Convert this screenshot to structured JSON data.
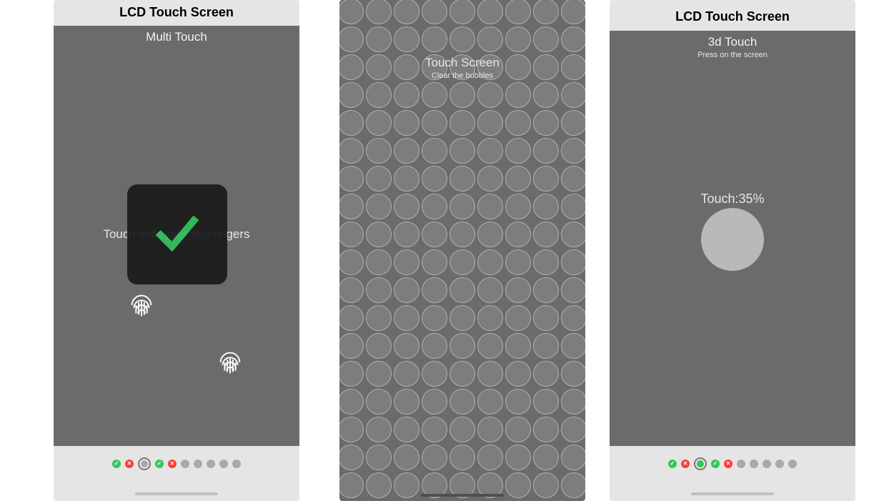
{
  "screen1": {
    "header": "LCD Touch Screen",
    "subtitle": "Multi Touch",
    "instruction": "Touch with your two fingers",
    "dots": [
      "pass",
      "fail",
      "current-todo",
      "pass",
      "fail",
      "todo",
      "todo",
      "todo",
      "todo",
      "todo"
    ]
  },
  "screen2": {
    "title": "Touch Screen",
    "subtitle": "Clear the bubbles",
    "grid": {
      "rows": 18,
      "cols": 9
    }
  },
  "screen3": {
    "header": "LCD Touch Screen",
    "subtitle": "3d Touch",
    "subtext": "Press on the screen",
    "touch_label": "Touch:",
    "touch_value": "35%",
    "dots": [
      "pass",
      "fail",
      "current-pass",
      "pass",
      "fail",
      "todo",
      "todo",
      "todo",
      "todo",
      "todo"
    ]
  }
}
